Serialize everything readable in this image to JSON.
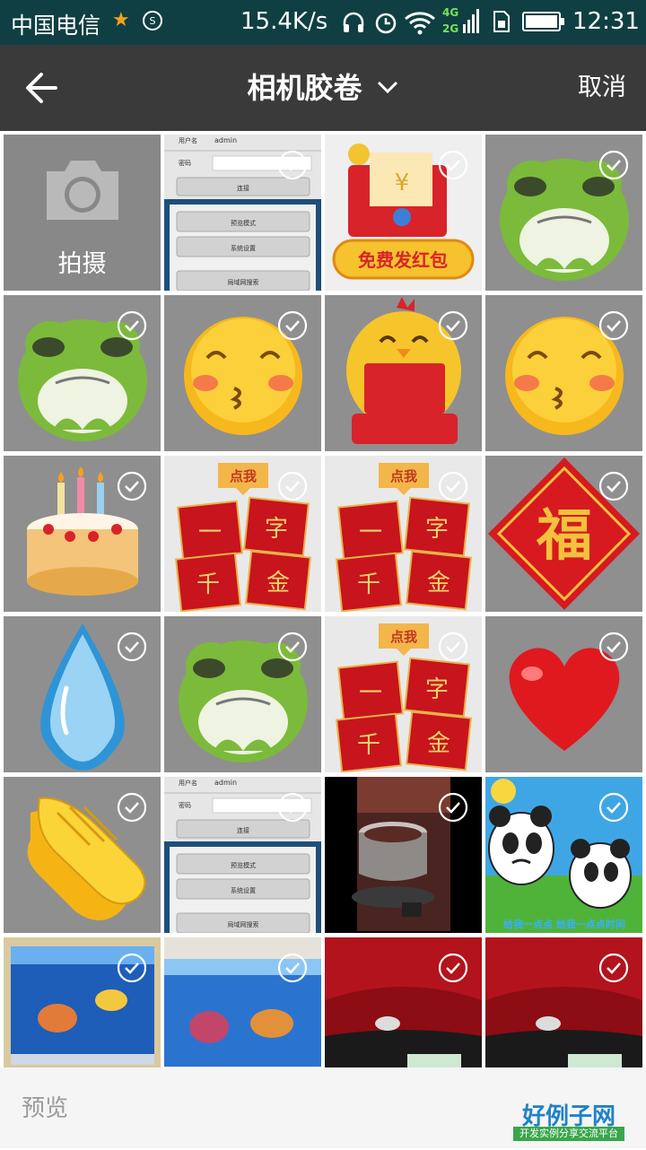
{
  "status_bar": {
    "carrier": "中国电信",
    "speed": "15.4K/s",
    "network_badge_top": "4G",
    "network_badge_bottom": "2G",
    "time": "12:31"
  },
  "title_bar": {
    "title": "相机胶卷",
    "cancel_label": "取消"
  },
  "camera_tile": {
    "label": "拍摄"
  },
  "thumbnails": {
    "login_screen": {
      "user_label": "用户名",
      "user_value": "admin",
      "password_label": "密码",
      "connect_btn": "连接",
      "preview_mode": "预览模式",
      "system_settings": "系统设置",
      "lan_search": "局域网搜索"
    },
    "red_packet_banner": "免费发红包",
    "red_packet_yuan": "¥",
    "red_packets_tag": "点我",
    "red_packet_chars": [
      "一",
      "字",
      "千",
      "金"
    ],
    "fu_character": "福",
    "panda_caption": "给我一点点 给我一点点时间"
  },
  "bottom_bar": {
    "preview_label": "预览",
    "brand_name": "好例子网",
    "brand_tagline": "开发实例分享交流平台"
  },
  "colors": {
    "status_bar_bg": "#0f3f43",
    "title_bar_bg": "#3a3a3a",
    "tile_bg": "#8f8f8f",
    "bottom_bar_bg": "#f5f5f5"
  }
}
